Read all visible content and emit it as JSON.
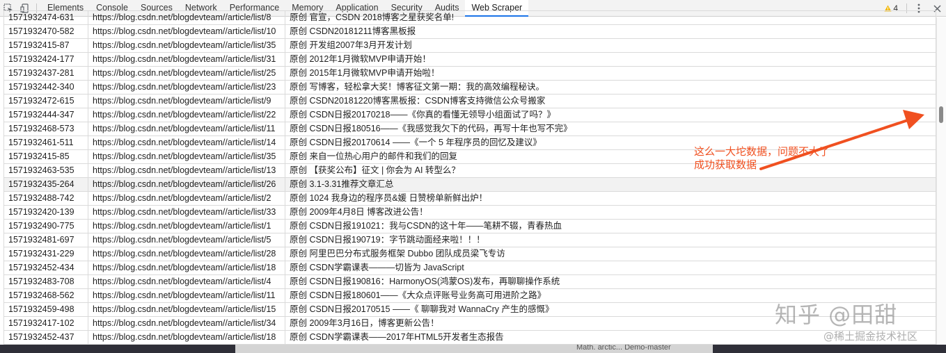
{
  "devtools": {
    "tabs": [
      "Elements",
      "Console",
      "Sources",
      "Network",
      "Performance",
      "Memory",
      "Application",
      "Security",
      "Audits",
      "Web Scraper"
    ],
    "active_tab": "Web Scraper",
    "warning_count": "4",
    "icons": [
      "inspect-element-icon",
      "device-toggle-icon",
      "warning-icon",
      "more-options-icon",
      "close-icon"
    ],
    "colors": {
      "active_tab_underline": "#1a73e8",
      "warning": "#f2b705"
    }
  },
  "table": {
    "rows": [
      {
        "id": "1571932474-631",
        "url": "https://blog.csdn.net/blogdevteam//article/list/8",
        "title": "原创 官宣，CSDN 2018博客之星获奖名单!"
      },
      {
        "id": "1571932470-582",
        "url": "https://blog.csdn.net/blogdevteam//article/list/10",
        "title": "原创 CSDN20181211博客黑板报"
      },
      {
        "id": "1571932415-87",
        "url": "https://blog.csdn.net/blogdevteam//article/list/35",
        "title": "原创 开发组2007年3月开发计划"
      },
      {
        "id": "1571932424-177",
        "url": "https://blog.csdn.net/blogdevteam//article/list/31",
        "title": "原创 2012年1月微软MVP申请开始！"
      },
      {
        "id": "1571932437-281",
        "url": "https://blog.csdn.net/blogdevteam//article/list/25",
        "title": "原创 2015年1月微软MVP申请开始啦！"
      },
      {
        "id": "1571932442-340",
        "url": "https://blog.csdn.net/blogdevteam//article/list/23",
        "title": "原创 写博客，轻松拿大奖！博客征文第一期：我的高效编程秘诀。"
      },
      {
        "id": "1571932472-615",
        "url": "https://blog.csdn.net/blogdevteam//article/list/9",
        "title": "原创 CSDN20181220博客黑板报：CSDN博客支持微信公众号搬家"
      },
      {
        "id": "1571932444-347",
        "url": "https://blog.csdn.net/blogdevteam//article/list/22",
        "title": "原创 CSDN日报20170218——《你真的看懂无领导小组面试了吗？》"
      },
      {
        "id": "1571932468-573",
        "url": "https://blog.csdn.net/blogdevteam//article/list/11",
        "title": "原创 CSDN日报180516——《我感觉我欠下的代码，再写十年也写不完》"
      },
      {
        "id": "1571932461-511",
        "url": "https://blog.csdn.net/blogdevteam//article/list/14",
        "title": "原创 CSDN日报20170614 ——《一个 5 年程序员的回忆及建议》"
      },
      {
        "id": "1571932415-85",
        "url": "https://blog.csdn.net/blogdevteam//article/list/35",
        "title": "原创 来自一位热心用户的邮件和我们的回复"
      },
      {
        "id": "1571932463-535",
        "url": "https://blog.csdn.net/blogdevteam//article/list/13",
        "title": "原创 【获奖公布】征文 | 你会为 AI 转型么？"
      },
      {
        "id": "1571932435-264",
        "url": "https://blog.csdn.net/blogdevteam//article/list/26",
        "title": "原创 3.1-3.31推荐文章汇总"
      },
      {
        "id": "1571932488-742",
        "url": "https://blog.csdn.net/blogdevteam//article/list/2",
        "title": "原创 1024 我身边的程序员&媛 日赞榜单新鲜出炉！"
      },
      {
        "id": "1571932420-139",
        "url": "https://blog.csdn.net/blogdevteam//article/list/33",
        "title": "原创 2009年4月8日 博客改进公告！"
      },
      {
        "id": "1571932490-775",
        "url": "https://blog.csdn.net/blogdevteam//article/list/1",
        "title": "原创 CSDN日报191021：我与CSDN的这十年——笔耕不辍，青春热血"
      },
      {
        "id": "1571932481-697",
        "url": "https://blog.csdn.net/blogdevteam//article/list/5",
        "title": "原创 CSDN日报190719：字节跳动面经来啦！！！"
      },
      {
        "id": "1571932431-229",
        "url": "https://blog.csdn.net/blogdevteam//article/list/28",
        "title": "原创 阿里巴巴分布式服务框架 Dubbo 团队成员梁飞专访"
      },
      {
        "id": "1571932452-434",
        "url": "https://blog.csdn.net/blogdevteam//article/list/18",
        "title": "原创 CSDN学霸课表———切皆为 JavaScript"
      },
      {
        "id": "1571932483-708",
        "url": "https://blog.csdn.net/blogdevteam//article/list/4",
        "title": "原创 CSDN日报190816：HarmonyOS(鸿蒙OS)发布，再聊聊操作系统"
      },
      {
        "id": "1571932468-562",
        "url": "https://blog.csdn.net/blogdevteam//article/list/11",
        "title": "原创 CSDN日报180601——《大众点评账号业务高可用进阶之路》"
      },
      {
        "id": "1571932459-498",
        "url": "https://blog.csdn.net/blogdevteam//article/list/15",
        "title": "原创 CSDN日报20170515 ——《 聊聊我对 WannaCry 产生的感慨》"
      },
      {
        "id": "1571932417-102",
        "url": "https://blog.csdn.net/blogdevteam//article/list/34",
        "title": "原创 2009年3月16日，博客更新公告！"
      },
      {
        "id": "1571932452-437",
        "url": "https://blog.csdn.net/blogdevteam//article/list/18",
        "title": "原创 CSDN学霸课表——2017年HTML5开发者生态报告"
      }
    ],
    "highlighted_row": 12
  },
  "annotation": {
    "line1": "这么一大坨数据，问题不大了",
    "line2": "成功获取数据",
    "color": "#f05020"
  },
  "watermarks": {
    "zhihu": "知乎 @田甜",
    "juejin": "@稀土掘金技术社区"
  },
  "taskbar": {
    "text": "Math. arctic... Demo-master"
  }
}
